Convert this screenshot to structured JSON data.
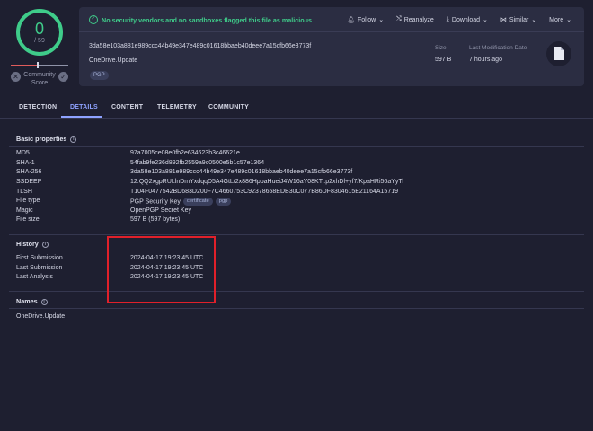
{
  "score": {
    "detections": "0",
    "total": "/ 59",
    "community_label": "Community Score",
    "x_icon": "close-icon",
    "ok_icon": "check-icon"
  },
  "banner": {
    "message": "No security vendors and no sandboxes flagged this file as malicious",
    "icon": "check-circle-icon"
  },
  "actions": [
    {
      "icon": "bell-icon",
      "label": "Follow",
      "chevron": true
    },
    {
      "icon": "reanalyze-icon",
      "label": "Reanalyze",
      "chevron": false
    },
    {
      "icon": "download-icon",
      "label": "Download",
      "chevron": true
    },
    {
      "icon": "similar-icon",
      "label": "Similar",
      "chevron": true
    },
    {
      "icon": "",
      "label": "More",
      "chevron": true
    }
  ],
  "file": {
    "sha256": "3da58e103a881e989ccc44b49e347e489c01618bbaeb40deee7a15cfb66e3773f",
    "name": "OneDrive.Update",
    "tag": "PGP",
    "size_label": "Size",
    "size_value": "597 B",
    "last_mod_label": "Last Modification Date",
    "last_mod_value": "7 hours ago",
    "type_icon": "document-icon"
  },
  "tabs": [
    "DETECTION",
    "DETAILS",
    "CONTENT",
    "TELEMETRY",
    "COMMUNITY"
  ],
  "active_tab": "DETAILS",
  "basic": {
    "title": "Basic properties",
    "rows": [
      {
        "k": "MD5",
        "v": "97a7005ce08e0fb2e634623b3c46621e"
      },
      {
        "k": "SHA-1",
        "v": "54fab9fe236d892fb2559a9c0500e5b1c57e1364"
      },
      {
        "k": "SHA-256",
        "v": "3da58e103a881e989ccc44b49e347e489c01618bbaeb40deee7a15cfb66e3773f"
      },
      {
        "k": "SSDEEP",
        "v": "12:QQ2xgpRULlnDmYxdqqD5A4GtL/2x886HppaHueiJ4W16aY08KTi:p2xhDl+yf7/KpaHRi56aYyTi"
      },
      {
        "k": "TLSH",
        "v": "T104F0477542BD683D200F7C4660753C92378658EDB30C077B86DF8304615E21164A15719"
      },
      {
        "k": "File type",
        "v": "PGP Security Key"
      },
      {
        "k": "Magic",
        "v": "OpenPGP Secret Key"
      },
      {
        "k": "File size",
        "v": "597 B (597 bytes)"
      }
    ],
    "file_type_tags": [
      "certificate",
      "pgp"
    ]
  },
  "history": {
    "title": "History",
    "rows": [
      {
        "k": "First Submission",
        "v": "2024-04-17 19:23:45 UTC"
      },
      {
        "k": "Last Submission",
        "v": "2024-04-17 19:23:45 UTC"
      },
      {
        "k": "Last Analysis",
        "v": "2024-04-17 19:23:45 UTC"
      }
    ]
  },
  "names": {
    "title": "Names",
    "values": [
      "OneDrive.Update"
    ]
  },
  "colors": {
    "accent_green": "#3fcc8a",
    "accent_blue": "#8ea2ff",
    "highlight_red": "#e0202a",
    "background": "#1e1f30",
    "card": "#2b2d42"
  }
}
